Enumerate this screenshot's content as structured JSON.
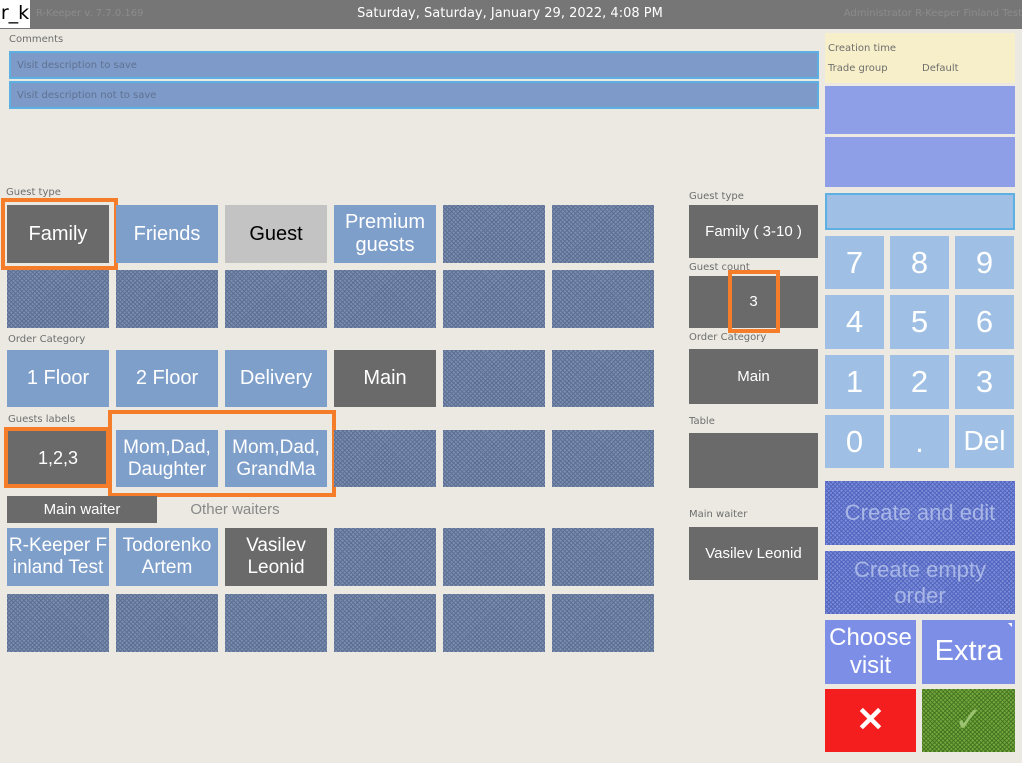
{
  "header": {
    "logo": "r_k",
    "version": "R-Keeper v. 7.7.0.169",
    "datetime": "Saturday, Saturday, January 29, 2022, 4:08 PM",
    "user": "Administrator R-Keeper Finland Test"
  },
  "comments": {
    "label": "Comments",
    "rows": [
      "Visit description to save",
      "Visit description not to save"
    ]
  },
  "guest_type": {
    "label": "Guest type",
    "items": [
      "Family",
      "Friends",
      "Guest",
      "Premium guests"
    ],
    "selected": "Family"
  },
  "order_category": {
    "label": "Order Category",
    "items": [
      "1 Floor",
      "2 Floor",
      "Delivery",
      "Main"
    ],
    "selected": "Main"
  },
  "guest_labels": {
    "label": "Guests labels",
    "items": [
      "1,2,3",
      "Mom,Dad, Daughter",
      "Mom,Dad, GrandMa"
    ],
    "selected": "1,2,3"
  },
  "waiters": {
    "tabs": [
      "Main waiter",
      "Other waiters"
    ],
    "active_tab": "Main waiter",
    "items": [
      "R-Keeper Finland Test",
      "Todorenko Artem",
      "Vasilev Leonid"
    ],
    "selected": "Vasilev Leonid"
  },
  "summary": {
    "guest_type_label": "Guest type",
    "guest_type_value": "Family ( 3-10 )",
    "guest_count_label": "Guest count",
    "guest_count_value": "3",
    "order_category_label": "Order Category",
    "order_category_value": "Main",
    "table_label": "Table",
    "table_value": "",
    "main_waiter_label": "Main waiter",
    "main_waiter_value": "Vasilev Leonid"
  },
  "info": {
    "creation_time_label": "Creation time",
    "trade_group_label": "Trade group",
    "trade_group_value": "Default"
  },
  "keypad": [
    "7",
    "8",
    "9",
    "4",
    "5",
    "6",
    "1",
    "2",
    "3",
    "0",
    ".",
    "Del"
  ],
  "actions": {
    "create_and_edit": "Create and edit",
    "create_empty_order": "Create empty order",
    "choose_visit": "Choose visit",
    "extra": "Extra",
    "cancel_symbol": "✕",
    "ok_symbol": "✓"
  },
  "colors": {
    "accent_orange": "#f57d2a",
    "button_blue": "#7f9fcb",
    "button_dark": "#6a6a6a",
    "cancel_red": "#f41e1e",
    "ok_green": "#75a53b"
  }
}
